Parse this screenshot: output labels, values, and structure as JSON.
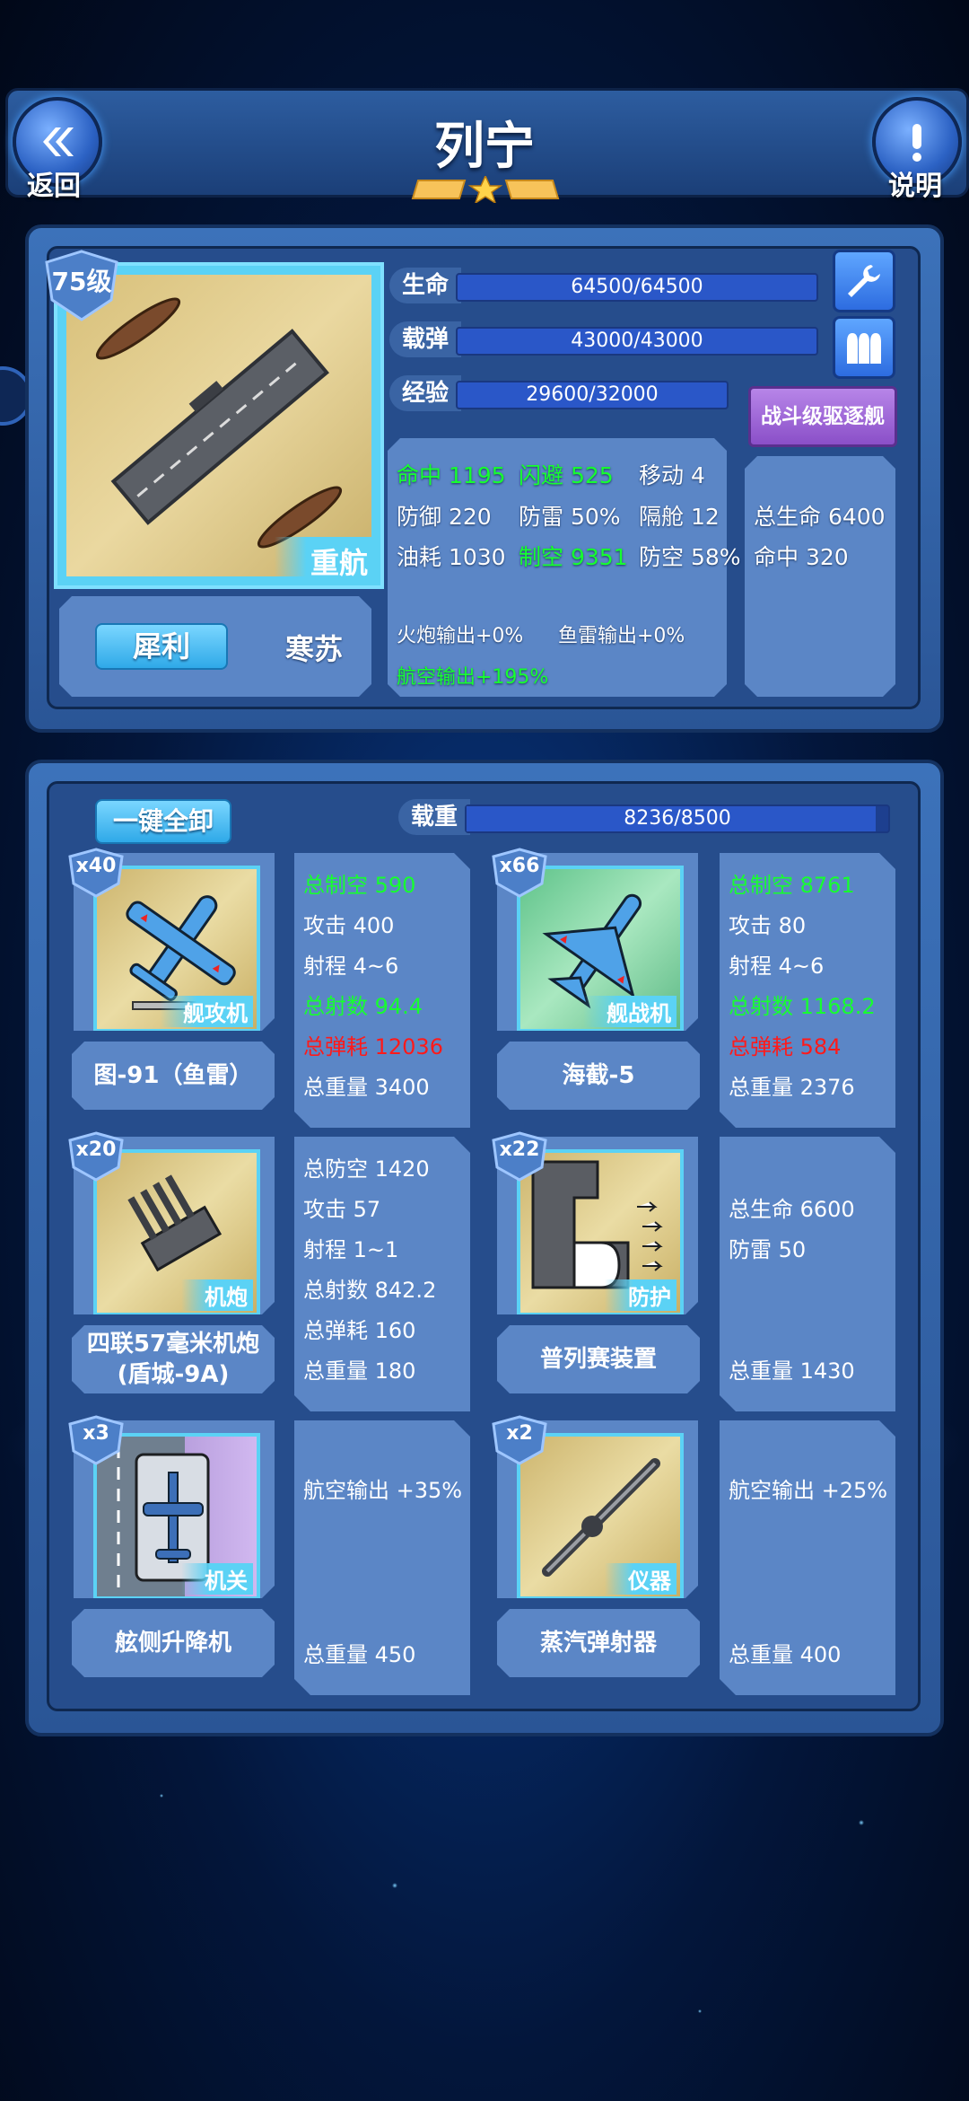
{
  "header": {
    "title": "列宁",
    "back_label": "返回",
    "help_label": "说明",
    "stars": 1
  },
  "ship": {
    "level": "75级",
    "type_tag": "重航",
    "stats": [
      {
        "label": "生命",
        "value": "64500/64500"
      },
      {
        "label": "载弹",
        "value": "43000/43000"
      },
      {
        "label": "经验",
        "value": "29600/32000"
      }
    ],
    "class_button": "战斗级驱逐舰",
    "names": {
      "active": "犀利",
      "other": "寒苏"
    },
    "attrs": {
      "row1": [
        "命中 1195",
        "闪避 525",
        "移动 4"
      ],
      "row2": [
        "防御 220",
        "防雷 50%",
        "隔舱 12"
      ],
      "row3": [
        "油耗 1030",
        "制空 9351",
        "防空 58%"
      ],
      "bonus1": "火炮输出+0%",
      "bonus2": "鱼雷输出+0%",
      "bonus3": "航空输出+195%"
    },
    "class_stats": [
      "总生命 6400",
      "命中 320"
    ]
  },
  "equipment_panel": {
    "unload_all": "一键全卸",
    "load_label": "载重",
    "load_value": "8236/8500",
    "load_fraction": 0.969
  },
  "equipment": [
    {
      "count": "x40",
      "tag": "舰攻机",
      "name": "图-91（鱼雷）",
      "icon": "torpedo-bomber-icon",
      "stats": [
        {
          "t": "总制空 590",
          "c": "green"
        },
        {
          "t": "攻击 400",
          "c": ""
        },
        {
          "t": "射程 4~6",
          "c": ""
        },
        {
          "t": "总射数 94.4",
          "c": "green"
        },
        {
          "t": "总弹耗 12036",
          "c": "red"
        },
        {
          "t": "总重量 3400",
          "c": ""
        }
      ]
    },
    {
      "count": "x66",
      "tag": "舰战机",
      "name": "海截-5",
      "icon": "fighter-jet-icon",
      "stats": [
        {
          "t": "总制空 8761",
          "c": "green"
        },
        {
          "t": "攻击 80",
          "c": ""
        },
        {
          "t": "射程 4~6",
          "c": ""
        },
        {
          "t": "总射数 1168.2",
          "c": "green"
        },
        {
          "t": "总弹耗 584",
          "c": "red"
        },
        {
          "t": "总重量 2376",
          "c": ""
        }
      ]
    },
    {
      "count": "x20",
      "tag": "机炮",
      "name1": "四联57毫米机炮",
      "name2": "(盾城-9A)",
      "icon": "autocannon-icon",
      "stats": [
        {
          "t": "总防空 1420",
          "c": ""
        },
        {
          "t": "攻击 57",
          "c": ""
        },
        {
          "t": "射程 1~1",
          "c": ""
        },
        {
          "t": "总射数 842.2",
          "c": ""
        },
        {
          "t": "总弹耗 160",
          "c": ""
        },
        {
          "t": "总重量 180",
          "c": ""
        }
      ]
    },
    {
      "count": "x22",
      "tag": "防护",
      "name": "普列赛装置",
      "icon": "protection-device-icon",
      "stats": [
        {
          "t": "总生命 6600",
          "c": ""
        },
        {
          "t": "防雷 50",
          "c": ""
        },
        {
          "t": "总重量 1430",
          "c": ""
        }
      ]
    },
    {
      "count": "x3",
      "tag": "机关",
      "name": "舷侧升降机",
      "icon": "elevator-icon",
      "stats": [
        {
          "t": "航空输出 +35%",
          "c": ""
        },
        {
          "t": "总重量 450",
          "c": ""
        }
      ]
    },
    {
      "count": "x2",
      "tag": "仪器",
      "name": "蒸汽弹射器",
      "icon": "catapult-icon",
      "stats": [
        {
          "t": "航空输出 +25%",
          "c": ""
        },
        {
          "t": "总重量 400",
          "c": ""
        }
      ]
    }
  ]
}
